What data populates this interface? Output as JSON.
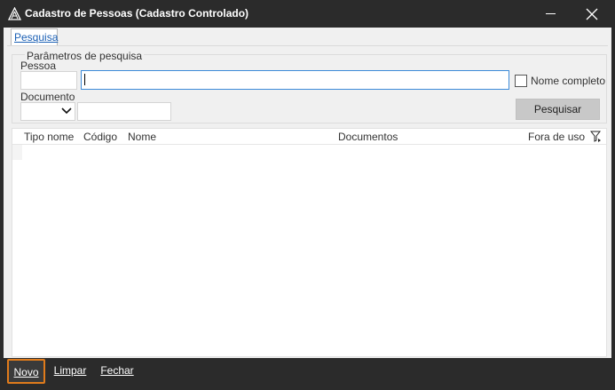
{
  "window": {
    "title": "Cadastro de Pessoas (Cadastro Controlado)"
  },
  "tabs": [
    {
      "label": "Pesquisa",
      "active": true
    }
  ],
  "search_params": {
    "legend": "Parâmetros de pesquisa",
    "pessoa_label": "Pessoa",
    "pessoa_code_value": "",
    "pessoa_name_value": "",
    "nome_completo_label": "Nome completo",
    "nome_completo_checked": false,
    "documento_label": "Documento",
    "documento_type_value": "",
    "documento_value": "",
    "pesquisar_label": "Pesquisar"
  },
  "grid": {
    "columns": [
      "Tipo nome",
      "Código",
      "Nome",
      "Documentos",
      "Fora de uso"
    ],
    "rows": []
  },
  "bottom_bar": {
    "novo_label": "Novo",
    "limpar_label": "Limpar",
    "fechar_label": "Fechar"
  },
  "colors": {
    "titlebar": "#2b2b2b",
    "client": "#f0f0f0",
    "focus_border": "#3d8bd9",
    "highlight_border": "#e07b1b",
    "tab_text": "#1a5fb4"
  }
}
